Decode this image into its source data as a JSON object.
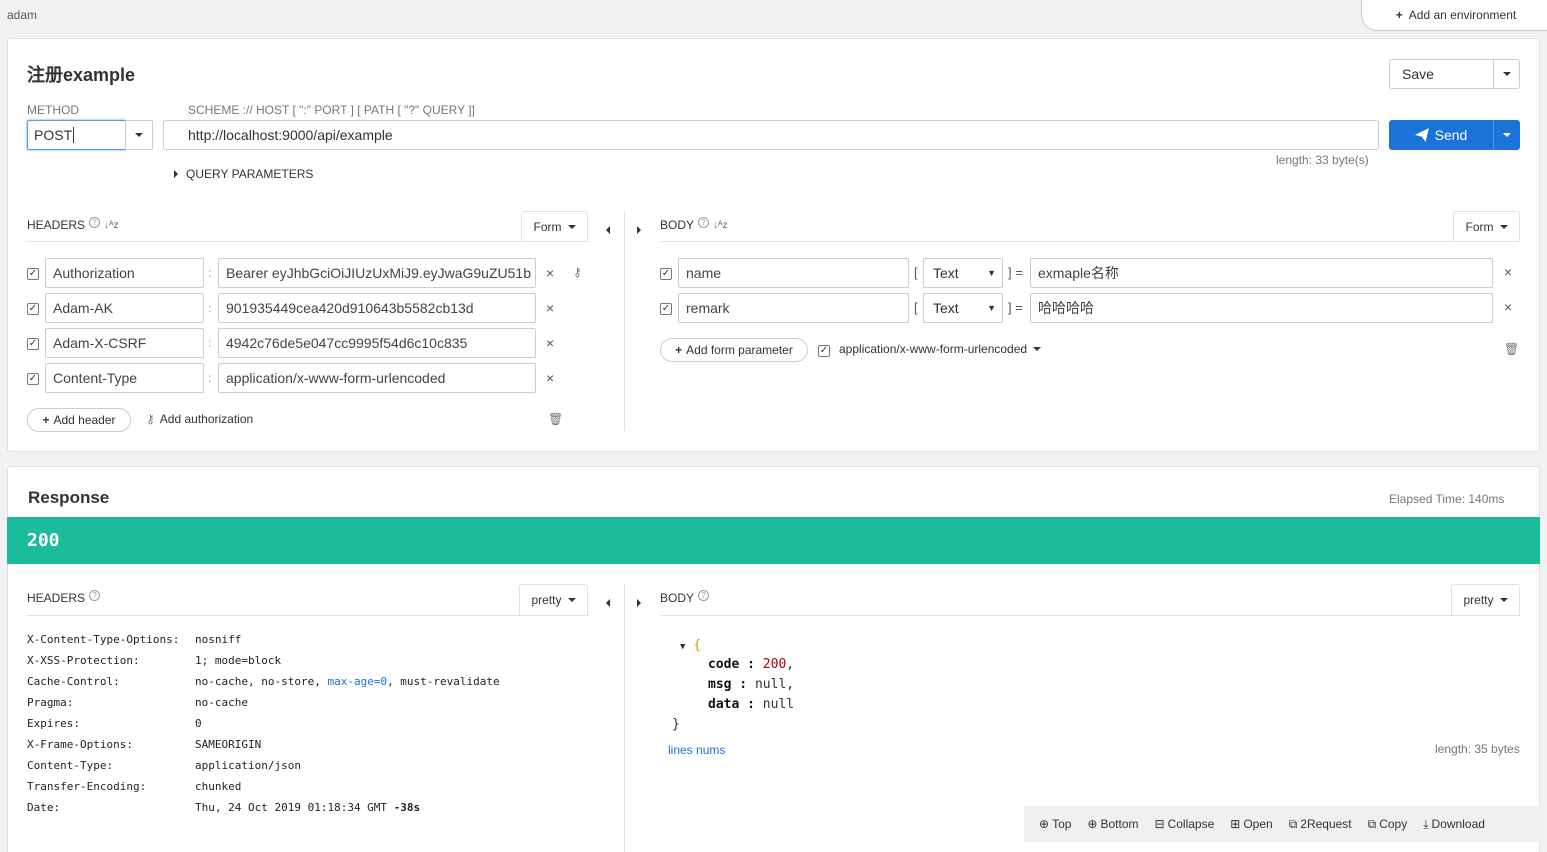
{
  "topbar": {
    "user": "adam",
    "add_env_label": "Add an environment"
  },
  "request": {
    "title": "注册example",
    "save_label": "Save",
    "method_label": "METHOD",
    "method_value": "POST",
    "url_label": "SCHEME :// HOST [ \":\" PORT ] [ PATH [ \"?\" QUERY ]]",
    "url_value": "http://localhost:9000/api/example",
    "send_label": "Send",
    "url_length": "length: 33 byte(s)",
    "query_params_label": "QUERY PARAMETERS",
    "headers_label": "HEADERS",
    "headers_mode": "Form",
    "headers": [
      {
        "key": "Authorization",
        "value": "Bearer eyJhbGciOiJIUzUxMiJ9.eyJwaG9uZU51b"
      },
      {
        "key": "Adam-AK",
        "value": "901935449cea420d910643b5582cb13d"
      },
      {
        "key": "Adam-X-CSRF",
        "value": "4942c76de5e047cc9995f54d6c10c835"
      },
      {
        "key": "Content-Type",
        "value": "application/x-www-form-urlencoded"
      }
    ],
    "add_header_label": "Add header",
    "add_authorization_label": "Add authorization",
    "body_label": "BODY",
    "body_mode": "Form",
    "body_params": [
      {
        "key": "name",
        "type": "Text",
        "value": "exmaple名称"
      },
      {
        "key": "remark",
        "type": "Text",
        "value": "哈哈哈哈"
      }
    ],
    "add_form_param_label": "Add form parameter",
    "content_type": "application/x-www-form-urlencoded"
  },
  "response": {
    "title": "Response",
    "elapsed": "Elapsed Time: 140ms",
    "status": "200",
    "headers_label": "HEADERS",
    "headers_mode": "pretty",
    "body_label": "BODY",
    "body_mode": "pretty",
    "headers": [
      {
        "key": "X-Content-Type-Options:",
        "value": "nosniff"
      },
      {
        "key": "X-XSS-Protection:",
        "value": "1; mode=block"
      },
      {
        "key": "Cache-Control:",
        "value_pre": "no-cache, no-store, ",
        "value_link": "max-age=0",
        "value_post": ", must-revalidate"
      },
      {
        "key": "Pragma:",
        "value": "no-cache"
      },
      {
        "key": "Expires:",
        "value": "0"
      },
      {
        "key": "X-Frame-Options:",
        "value": "SAMEORIGIN"
      },
      {
        "key": "Content-Type:",
        "value": "application/json"
      },
      {
        "key": "Transfer-Encoding:",
        "value": "chunked"
      },
      {
        "key": "Date:",
        "value": "Thu, 24 Oct 2019 01:18:34 GMT",
        "value_extra": "-38s"
      }
    ],
    "json": {
      "open": "{",
      "close": "}",
      "code_key": "code",
      "code_val": "200",
      "msg_key": "msg",
      "msg_val": "null",
      "data_key": "data",
      "data_val": "null"
    },
    "lines_nums_label": "lines nums",
    "body_length": "length: 35 bytes",
    "toolbar": {
      "top": "Top",
      "bottom": "Bottom",
      "collapse": "Collapse",
      "open": "Open",
      "to_request": "2Request",
      "copy": "Copy",
      "download": "Download"
    }
  }
}
